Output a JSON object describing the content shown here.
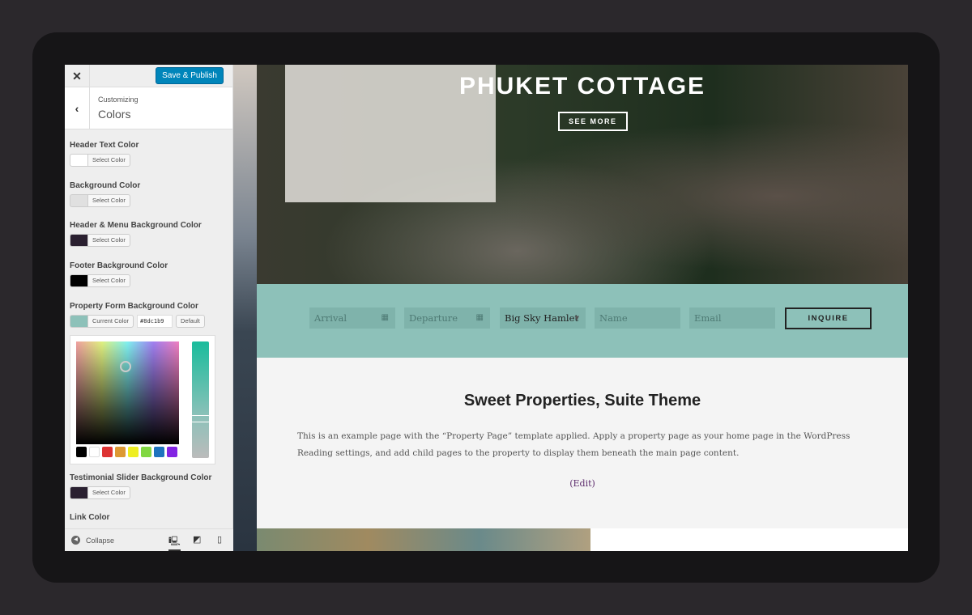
{
  "customizer": {
    "close_icon": "close-icon",
    "publish": "Save & Publish",
    "breadcrumb": "Customizing",
    "section": "Colors",
    "controls": [
      {
        "label": "Header Text Color",
        "color": "#ffffff",
        "button": "Select Color"
      },
      {
        "label": "Background Color",
        "color": "#e0e0e0",
        "button": "Select Color"
      },
      {
        "label": "Header & Menu Background Color",
        "color": "#2a2030",
        "button": "Select Color"
      },
      {
        "label": "Footer Background Color",
        "color": "#000000",
        "button": "Select Color"
      },
      {
        "label": "Property Form Background Color",
        "color": "#8dc1b9",
        "button": "Current Color",
        "hex": "#8dc1b9",
        "default": "Default"
      },
      {
        "label": "Testimonial Slider Background Color",
        "color": "#2a2030",
        "button": "Select Color"
      },
      {
        "label": "Link Color"
      }
    ],
    "palette": [
      "#000000",
      "#ffffff",
      "#dd3333",
      "#dd9933",
      "#eeee22",
      "#81d742",
      "#1e73be",
      "#8224e3"
    ],
    "collapse": "Collapse"
  },
  "site": {
    "title": "PHUKET COTTAGE",
    "see_more": "SEE MORE",
    "form": {
      "arrival": "Arrival",
      "departure": "Departure",
      "property": "Big Sky Hamlet",
      "name": "Name",
      "email": "Email",
      "inquire": "INQUIRE",
      "background": "#8dc1b9"
    },
    "heading": "Sweet Properties, Suite Theme",
    "body": "This is an example page with the “Property Page” template applied. Apply a property page as your home page in the WordPress Reading settings, and add child pages to the property to display them beneath the main page content.",
    "edit": "(Edit)"
  }
}
